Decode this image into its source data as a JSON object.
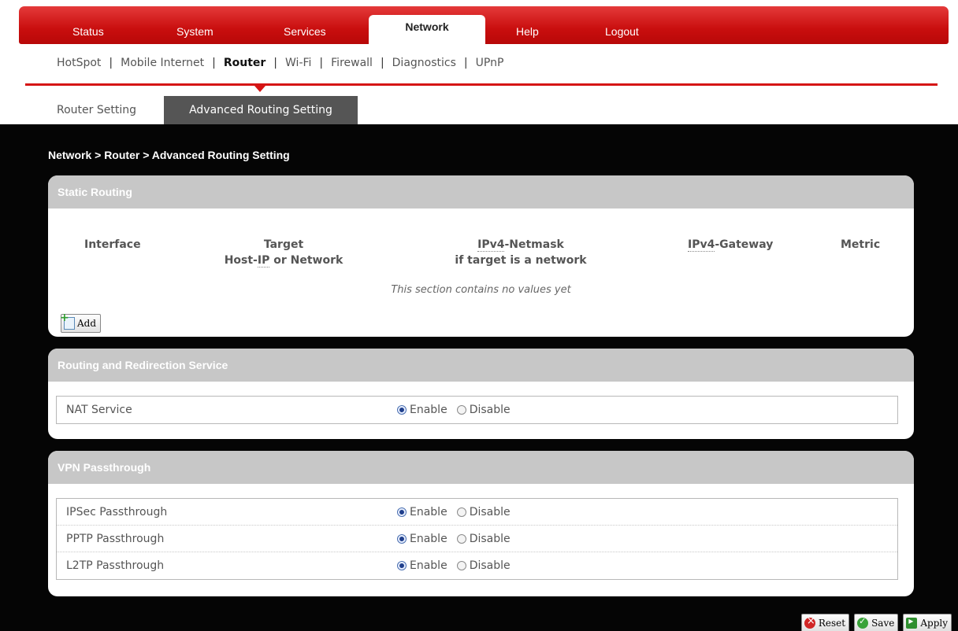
{
  "main_nav": {
    "tabs": [
      {
        "label": "Status"
      },
      {
        "label": "System"
      },
      {
        "label": "Services"
      },
      {
        "label": "Network"
      },
      {
        "label": "Help"
      },
      {
        "label": "Logout"
      }
    ],
    "active": "Network"
  },
  "sub_nav": {
    "items": [
      "HotSpot",
      "Mobile Internet",
      "Router",
      "Wi-Fi",
      "Firewall",
      "Diagnostics",
      "UPnP"
    ],
    "active": "Router"
  },
  "sub_tabs": {
    "router_setting": "Router Setting",
    "advanced_routing": "Advanced Routing Setting"
  },
  "breadcrumb": "Network > Router > Advanced Routing Setting",
  "static_routing": {
    "title": "Static Routing",
    "columns": {
      "interface": "Interface",
      "target_line1": "Target",
      "target_line2_pre": "Host-",
      "target_line2_ip": "IP",
      "target_line2_post": " or Network",
      "netmask_ipv4": "IPv4",
      "netmask_rest": "-Netmask",
      "netmask_line2": "if target is a network",
      "gateway_ipv4": "IPv4",
      "gateway_rest": "-Gateway",
      "metric": "Metric"
    },
    "empty_text": "This section contains no values yet",
    "add_label": "Add"
  },
  "routing_service": {
    "title": "Routing and Redirection Service",
    "rows": [
      {
        "label": "NAT Service",
        "enable": "Enable",
        "disable": "Disable",
        "value": "enable"
      }
    ]
  },
  "vpn": {
    "title": "VPN Passthrough",
    "rows": [
      {
        "label": "IPSec Passthrough",
        "enable": "Enable",
        "disable": "Disable",
        "value": "enable"
      },
      {
        "label": "PPTP Passthrough",
        "enable": "Enable",
        "disable": "Disable",
        "value": "enable"
      },
      {
        "label": "L2TP Passthrough",
        "enable": "Enable",
        "disable": "Disable",
        "value": "enable"
      }
    ]
  },
  "actions": {
    "reset": "Reset",
    "save": "Save",
    "apply": "Apply"
  },
  "colors": {
    "accent_red": "#d51515",
    "panel_header": "#c7c7c7",
    "background": "#050505"
  },
  "icons": {
    "add": "add-document-icon",
    "reset": "reset-icon",
    "save": "save-check-icon",
    "apply": "apply-icon"
  }
}
